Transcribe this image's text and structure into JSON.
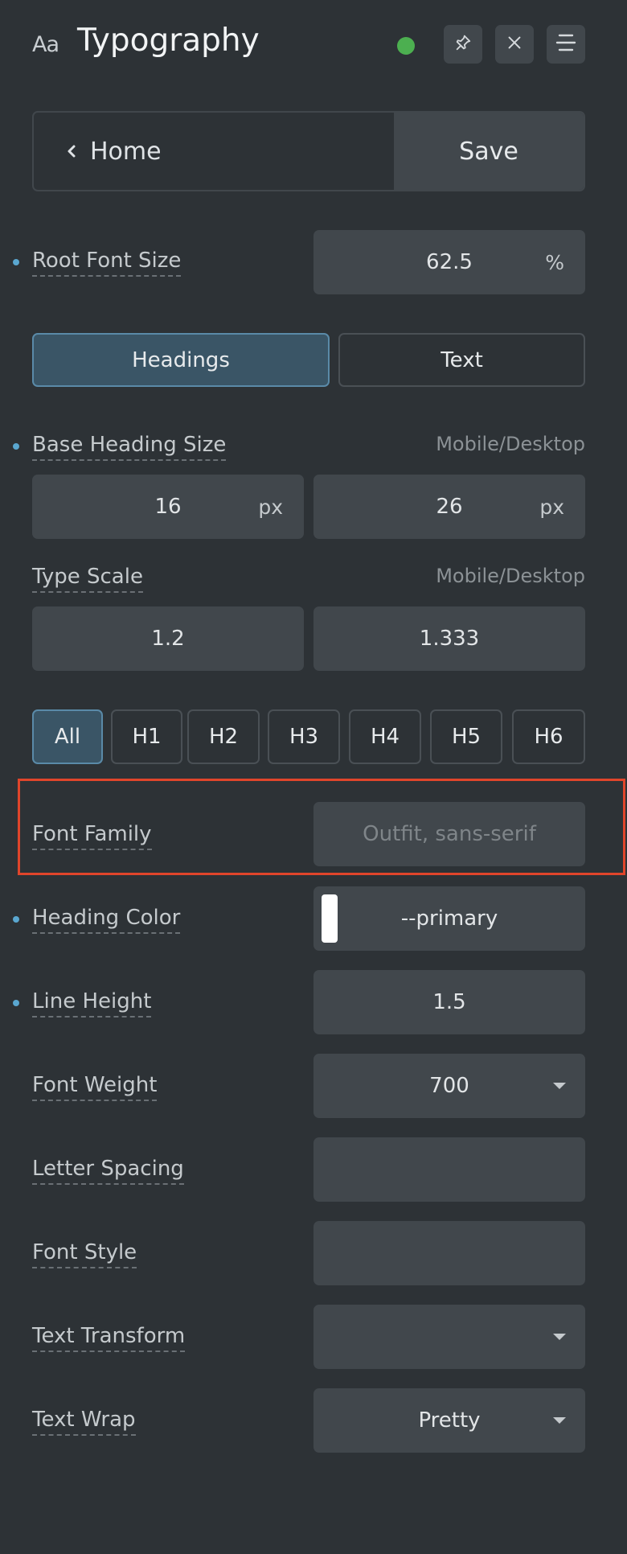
{
  "header": {
    "icon_text": "Aa",
    "title": "Typography",
    "status_color": "#4caf50",
    "icons": [
      "pin-icon",
      "close-icon",
      "menu-icon"
    ]
  },
  "nav": {
    "home_label": "Home",
    "save_label": "Save"
  },
  "root_font_size": {
    "label": "Root Font Size",
    "value": "62.5",
    "unit": "%"
  },
  "mode_tabs": {
    "headings": "Headings",
    "text": "Text",
    "active": "Headings"
  },
  "base_heading_size": {
    "label": "Base Heading Size",
    "hint": "Mobile/Desktop",
    "mobile": "16",
    "mobile_unit": "px",
    "desktop": "26",
    "desktop_unit": "px"
  },
  "type_scale": {
    "label": "Type Scale",
    "hint": "Mobile/Desktop",
    "mobile": "1.2",
    "desktop": "1.333"
  },
  "heading_tabs": [
    "All",
    "H1",
    "H2",
    "H3",
    "H4",
    "H5",
    "H6"
  ],
  "font_family": {
    "label": "Font Family",
    "placeholder": "Outfit, sans-serif"
  },
  "heading_color": {
    "label": "Heading Color",
    "value": "--primary",
    "swatch": "#ffffff"
  },
  "line_height": {
    "label": "Line Height",
    "value": "1.5"
  },
  "font_weight": {
    "label": "Font Weight",
    "value": "700"
  },
  "letter_spacing": {
    "label": "Letter Spacing",
    "value": ""
  },
  "font_style": {
    "label": "Font Style",
    "value": ""
  },
  "text_transform": {
    "label": "Text Transform",
    "value": ""
  },
  "text_wrap": {
    "label": "Text Wrap",
    "value": "Pretty"
  },
  "colors": {
    "accent": "#5aa7d0",
    "highlight": "#e0452b",
    "field_bg": "#41474c",
    "bg": "#2d3236"
  }
}
